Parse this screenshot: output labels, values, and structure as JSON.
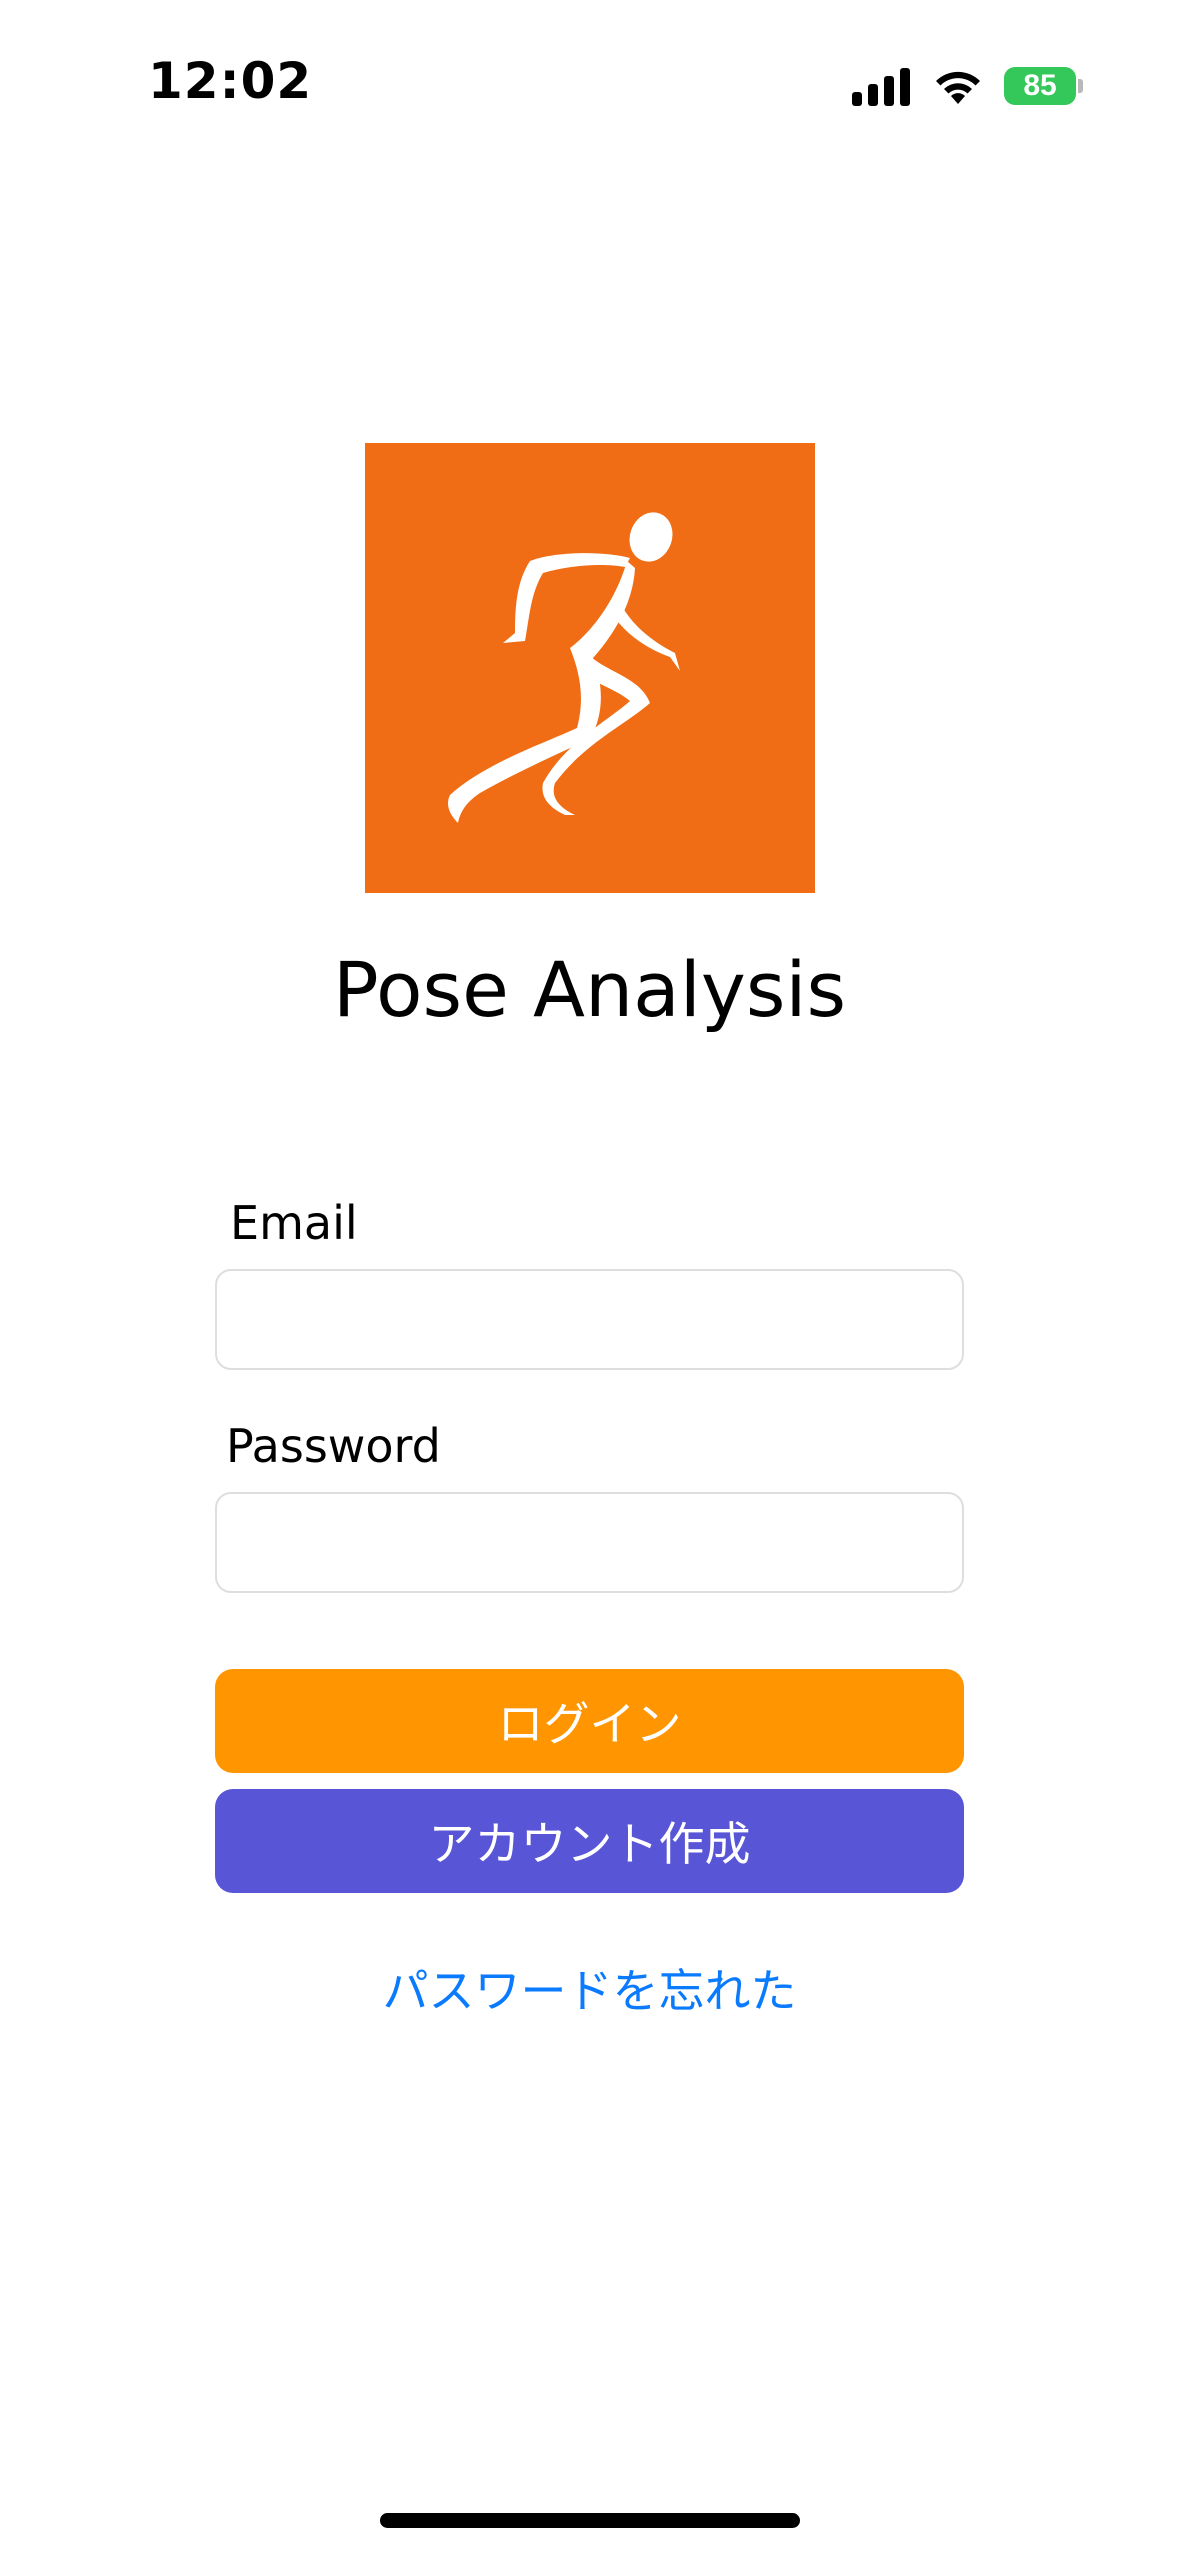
{
  "status_bar": {
    "time": "12:02",
    "battery_level": "85",
    "battery_color": "#34c759",
    "icons": [
      "cellular-signal-icon",
      "wifi-icon",
      "battery-charging-icon"
    ]
  },
  "logo": {
    "icon": "running-figure-icon",
    "background_color": "#f06d15"
  },
  "app": {
    "title": "Pose Analysis"
  },
  "form": {
    "email_label": "Email",
    "email_value": "",
    "password_label": "Password",
    "password_value": ""
  },
  "buttons": {
    "login_label": "ログイン",
    "login_color": "#ff9500",
    "signup_label": "アカウント作成",
    "signup_color": "#5856d6"
  },
  "links": {
    "forgot_password": "パスワードを忘れた",
    "link_color": "#0a7aff"
  }
}
